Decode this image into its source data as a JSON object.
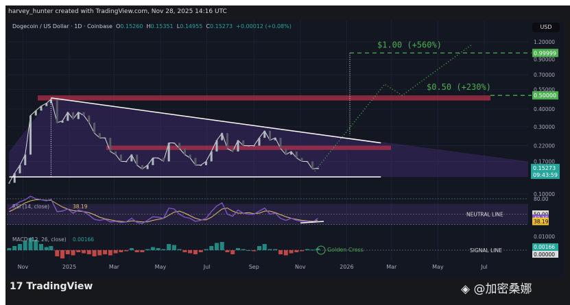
{
  "header": {
    "credit": "harvey_hunter created with TradingView.com, Nov 28, 2025 14:16 UTC"
  },
  "legend": {
    "symbol": "Dogecoin / US Dollar · 1D · Coinbase",
    "o_label": "O",
    "o": "0.15260",
    "h_label": "H",
    "h": "0.15351",
    "l_label": "L",
    "l": "0.14955",
    "c_label": "C",
    "c": "0.15273",
    "change": "+0.00012 (+0.08%)"
  },
  "currency": "USD",
  "brand": {
    "logo_text": "TradingView",
    "watermark": "@加密桑娜"
  },
  "colors": {
    "background": "#131722",
    "price": "#e0e0e0",
    "target": "#4caf50",
    "resistance": "#b0304a",
    "rsi": "#7e57c2",
    "rsi_ma": "#e0c070",
    "macd_up": "#26a69a",
    "macd_down": "#ef5350",
    "last_price": "#26a69a"
  },
  "chart_data": [
    {
      "type": "candlestick-line",
      "scale": "log",
      "ylim": [
        0.09,
        1.3
      ],
      "y_ticks": [
        "1.20000",
        "0.90000",
        "0.70000",
        "0.55000",
        "0.40000",
        "0.30000",
        "0.22000",
        "0.17000",
        "0.10000"
      ],
      "y_tick_values": [
        1.2,
        0.9,
        0.7,
        0.55,
        0.4,
        0.3,
        0.22,
        0.17,
        0.1
      ],
      "x_ticks": [
        "Nov",
        "2025",
        "Mar",
        "May",
        "Jul",
        "Sep",
        "Nov",
        "2026",
        "Mar",
        "May",
        "Jul"
      ],
      "x_tick_dates": [
        "2024-11-01",
        "2025-01-01",
        "2025-03-01",
        "2025-05-01",
        "2025-07-01",
        "2025-09-01",
        "2025-11-01",
        "2026-01-01",
        "2026-03-01",
        "2026-05-01",
        "2026-07-01"
      ],
      "dates": [
        "2024-10-14",
        "2024-10-21",
        "2024-10-28",
        "2024-11-04",
        "2024-11-11",
        "2024-11-18",
        "2024-11-25",
        "2024-12-02",
        "2024-12-08",
        "2024-12-16",
        "2024-12-23",
        "2024-12-30",
        "2025-01-06",
        "2025-01-13",
        "2025-01-20",
        "2025-01-27",
        "2025-02-03",
        "2025-02-10",
        "2025-02-17",
        "2025-02-24",
        "2025-03-03",
        "2025-03-10",
        "2025-03-17",
        "2025-03-24",
        "2025-03-31",
        "2025-04-07",
        "2025-04-14",
        "2025-04-21",
        "2025-04-28",
        "2025-05-05",
        "2025-05-12",
        "2025-05-19",
        "2025-05-26",
        "2025-06-02",
        "2025-06-09",
        "2025-06-16",
        "2025-06-23",
        "2025-06-30",
        "2025-07-07",
        "2025-07-14",
        "2025-07-21",
        "2025-07-28",
        "2025-08-04",
        "2025-08-11",
        "2025-08-18",
        "2025-08-25",
        "2025-09-01",
        "2025-09-08",
        "2025-09-15",
        "2025-09-22",
        "2025-09-29",
        "2025-10-06",
        "2025-10-13",
        "2025-10-20",
        "2025-10-27",
        "2025-11-03",
        "2025-11-10",
        "2025-11-17",
        "2025-11-24"
      ],
      "close": [
        0.12,
        0.14,
        0.16,
        0.19,
        0.36,
        0.39,
        0.42,
        0.44,
        0.47,
        0.32,
        0.33,
        0.38,
        0.34,
        0.38,
        0.36,
        0.32,
        0.27,
        0.25,
        0.25,
        0.2,
        0.19,
        0.17,
        0.17,
        0.19,
        0.16,
        0.15,
        0.16,
        0.18,
        0.18,
        0.17,
        0.23,
        0.23,
        0.21,
        0.19,
        0.18,
        0.16,
        0.16,
        0.17,
        0.2,
        0.24,
        0.27,
        0.21,
        0.2,
        0.24,
        0.22,
        0.22,
        0.22,
        0.25,
        0.28,
        0.24,
        0.25,
        0.21,
        0.19,
        0.2,
        0.18,
        0.17,
        0.17,
        0.15,
        0.15273
      ],
      "last_price": "0.15273",
      "countdown": "09:43:59",
      "levels": [
        {
          "label": "$1.00 (+560%)",
          "value": 1.0,
          "tag": "0.99999"
        },
        {
          "label": "$0.50 (+230%)",
          "value": 0.5,
          "tag": "0.50000"
        }
      ],
      "resistance_zones": [
        [
          0.46,
          0.5
        ],
        [
          0.205,
          0.22
        ]
      ],
      "triangle": {
        "upper": [
          [
            "2024-12-08",
            0.48
          ],
          [
            "2026-02-15",
            0.23
          ]
        ],
        "lower": [
          [
            "2024-10-14",
            0.132
          ],
          [
            "2026-02-15",
            0.132
          ]
        ]
      },
      "projection": [
        [
          "2025-11-20",
          0.145
        ],
        [
          "2026-02-20",
          0.6
        ],
        [
          "2026-03-15",
          0.5
        ],
        [
          "2026-06-15",
          1.15
        ]
      ]
    },
    {
      "type": "line",
      "name": "RSI (14, close)",
      "title": "RSI (14, close)",
      "value": "42.15",
      "ma_value": "38.19",
      "ylim": [
        20,
        80
      ],
      "tick": "80.00",
      "neutral": "50.00",
      "neutral_label": "NEUTRAL LINE",
      "values": [
        60,
        68,
        74,
        78,
        85,
        80,
        78,
        76,
        79,
        55,
        56,
        60,
        52,
        58,
        55,
        48,
        40,
        38,
        40,
        35,
        36,
        34,
        35,
        42,
        34,
        32,
        38,
        45,
        44,
        42,
        62,
        60,
        50,
        44,
        42,
        36,
        38,
        42,
        55,
        66,
        72,
        50,
        46,
        58,
        52,
        50,
        50,
        56,
        62,
        50,
        52,
        42,
        38,
        42,
        38,
        36,
        36,
        34,
        42.15
      ],
      "ma_values": [
        55,
        60,
        66,
        72,
        76,
        78,
        78,
        77,
        77,
        70,
        64,
        60,
        57,
        56,
        55,
        53,
        49,
        44,
        41,
        39,
        37,
        36,
        35,
        37,
        36,
        35,
        35,
        38,
        40,
        42,
        48,
        54,
        56,
        52,
        47,
        42,
        39,
        39,
        44,
        52,
        60,
        62,
        56,
        52,
        52,
        53,
        51,
        52,
        56,
        56,
        53,
        49,
        45,
        42,
        40,
        38,
        37,
        36,
        38.19
      ]
    },
    {
      "type": "bar",
      "name": "MACD (12, 26, close)",
      "title": "MACD (12, 26, close)",
      "value": "0.00166",
      "tick": "0.01000",
      "zero": "0.00000",
      "signal_label": "SIGNAL LINE",
      "annotation": "Golden Cross",
      "values": [
        0.002,
        0.004,
        0.006,
        0.009,
        0.012,
        0.01,
        0.006,
        0.003,
        0.004,
        -0.006,
        -0.008,
        -0.004,
        -0.005,
        -0.002,
        -0.003,
        -0.004,
        -0.006,
        -0.005,
        -0.004,
        -0.005,
        -0.003,
        -0.002,
        -0.001,
        0.002,
        -0.002,
        -0.002,
        0.001,
        0.003,
        0.002,
        0.001,
        0.006,
        0.005,
        0.001,
        -0.002,
        -0.003,
        -0.004,
        -0.002,
        0.001,
        0.004,
        0.007,
        0.008,
        -0.002,
        -0.004,
        0.002,
        0.001,
        0.0,
        -0.001,
        0.004,
        0.006,
        0.001,
        0.001,
        -0.004,
        -0.005,
        -0.003,
        -0.002,
        -0.001,
        0.001,
        0.0005,
        0.00166
      ]
    }
  ]
}
